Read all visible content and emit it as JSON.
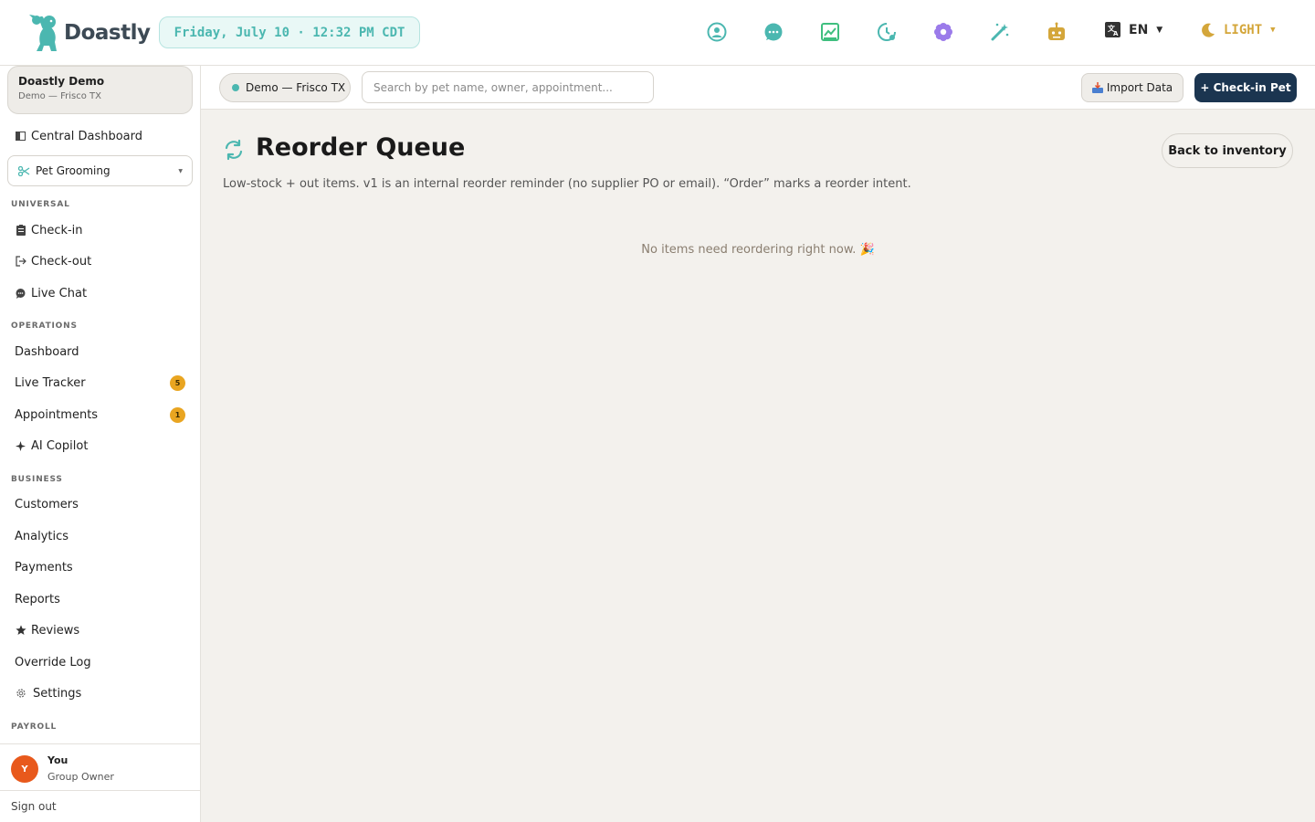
{
  "brand": {
    "name": "Doastly",
    "accent": "#4bb7b0"
  },
  "header": {
    "clock": "Friday, July 10 · 12:32 PM CDT",
    "icons": [
      "support-icon",
      "chat-icon",
      "analytics-icon",
      "timer-icon",
      "flower-icon",
      "magic-wand-icon",
      "robot-icon"
    ],
    "language": "EN",
    "theme": "LIGHT"
  },
  "sidebar": {
    "org_name": "Doastly Demo",
    "org_location": "Demo — Frisco TX",
    "central_dashboard": "Central Dashboard",
    "business_type": "Pet Grooming",
    "sections": {
      "universal": "UNIVERSAL",
      "operations": "OPERATIONS",
      "business": "BUSINESS",
      "payroll": "PAYROLL"
    },
    "items": {
      "checkin": "Check-in",
      "checkout": "Check-out",
      "live_chat": "Live Chat",
      "dashboard": "Dashboard",
      "live_tracker": "Live Tracker",
      "live_tracker_badge": "5",
      "appointments": "Appointments",
      "appointments_badge": "1",
      "ai_copilot": "AI Copilot",
      "customers": "Customers",
      "analytics": "Analytics",
      "payments": "Payments",
      "reports": "Reports",
      "reviews": "Reviews",
      "override_log": "Override Log",
      "settings": "Settings"
    },
    "user": {
      "initial": "Y",
      "name": "You",
      "role": "Group Owner"
    },
    "sign_out": "Sign out"
  },
  "subheader": {
    "location": "Demo — Frisco TX",
    "search_placeholder": "Search by pet name, owner, appointment...",
    "import_label": "Import Data",
    "checkin_label": "+ Check-in Pet"
  },
  "main": {
    "title": "Reorder Queue",
    "back_label": "Back to inventory",
    "description": "Low-stock + out items. v1 is an internal reorder reminder (no supplier PO or email). “Order” marks a reorder intent.",
    "empty_message": "No items need reordering right now. 🎉"
  }
}
